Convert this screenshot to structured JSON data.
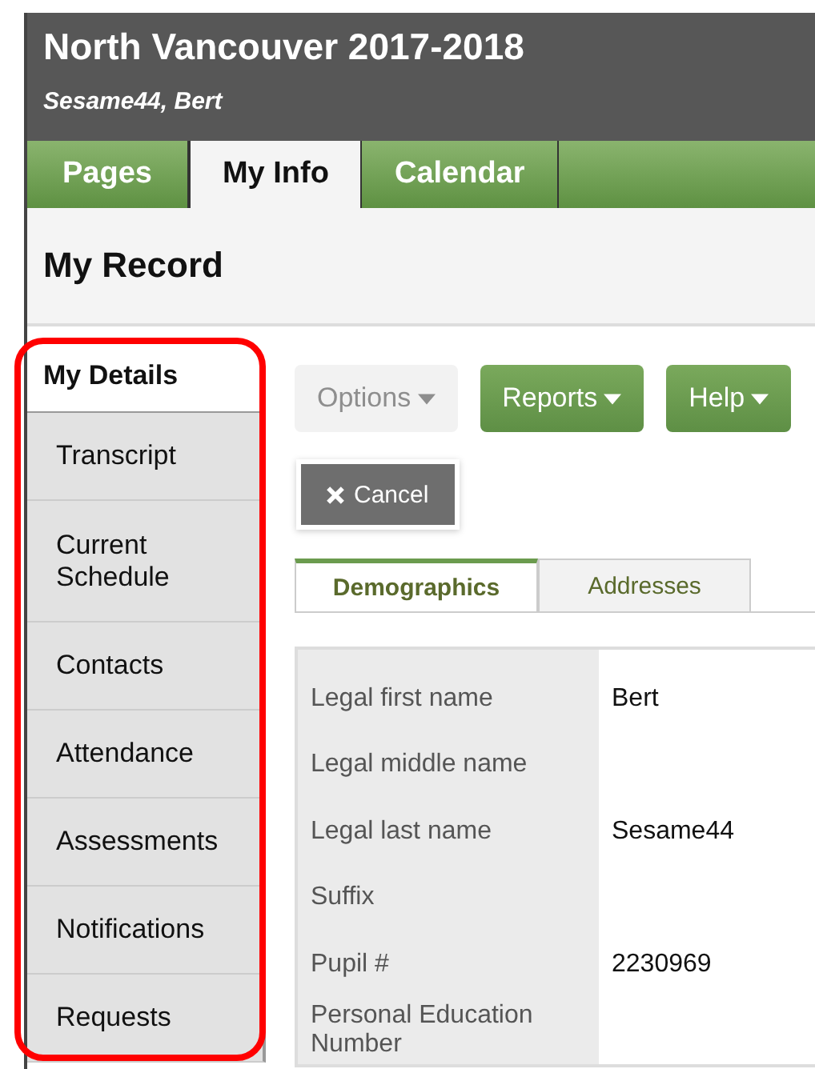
{
  "header": {
    "title": "North Vancouver 2017-2018",
    "user": "Sesame44, Bert"
  },
  "tabs": [
    {
      "label": "Pages",
      "selected": false
    },
    {
      "label": "My Info",
      "selected": true
    },
    {
      "label": "Calendar",
      "selected": false
    }
  ],
  "page_title": "My Record",
  "sidebar": {
    "highlighted": true,
    "items": [
      {
        "label": "My Details",
        "selected": true
      },
      {
        "label": "Transcript",
        "selected": false
      },
      {
        "label": "Current Schedule",
        "selected": false
      },
      {
        "label": "Contacts",
        "selected": false
      },
      {
        "label": "Attendance",
        "selected": false
      },
      {
        "label": "Assessments",
        "selected": false
      },
      {
        "label": "Notifications",
        "selected": false
      },
      {
        "label": "Requests",
        "selected": false
      }
    ]
  },
  "toolbar": [
    {
      "label": "Options",
      "disabled": true
    },
    {
      "label": "Reports",
      "disabled": false
    },
    {
      "label": "Help",
      "disabled": false
    }
  ],
  "cancel_button": "Cancel",
  "subtabs": [
    {
      "label": "Demographics",
      "selected": true
    },
    {
      "label": "Addresses",
      "selected": false
    }
  ],
  "fields": [
    {
      "label": "Legal first name",
      "value": "Bert"
    },
    {
      "label": "Legal middle name"
    },
    {
      "label": "Legal last name",
      "value": "Sesame44"
    },
    {
      "label": "Suffix"
    },
    {
      "label": "Pupil #",
      "value": "2230969"
    },
    {
      "label": "Personal Education Number"
    }
  ]
}
